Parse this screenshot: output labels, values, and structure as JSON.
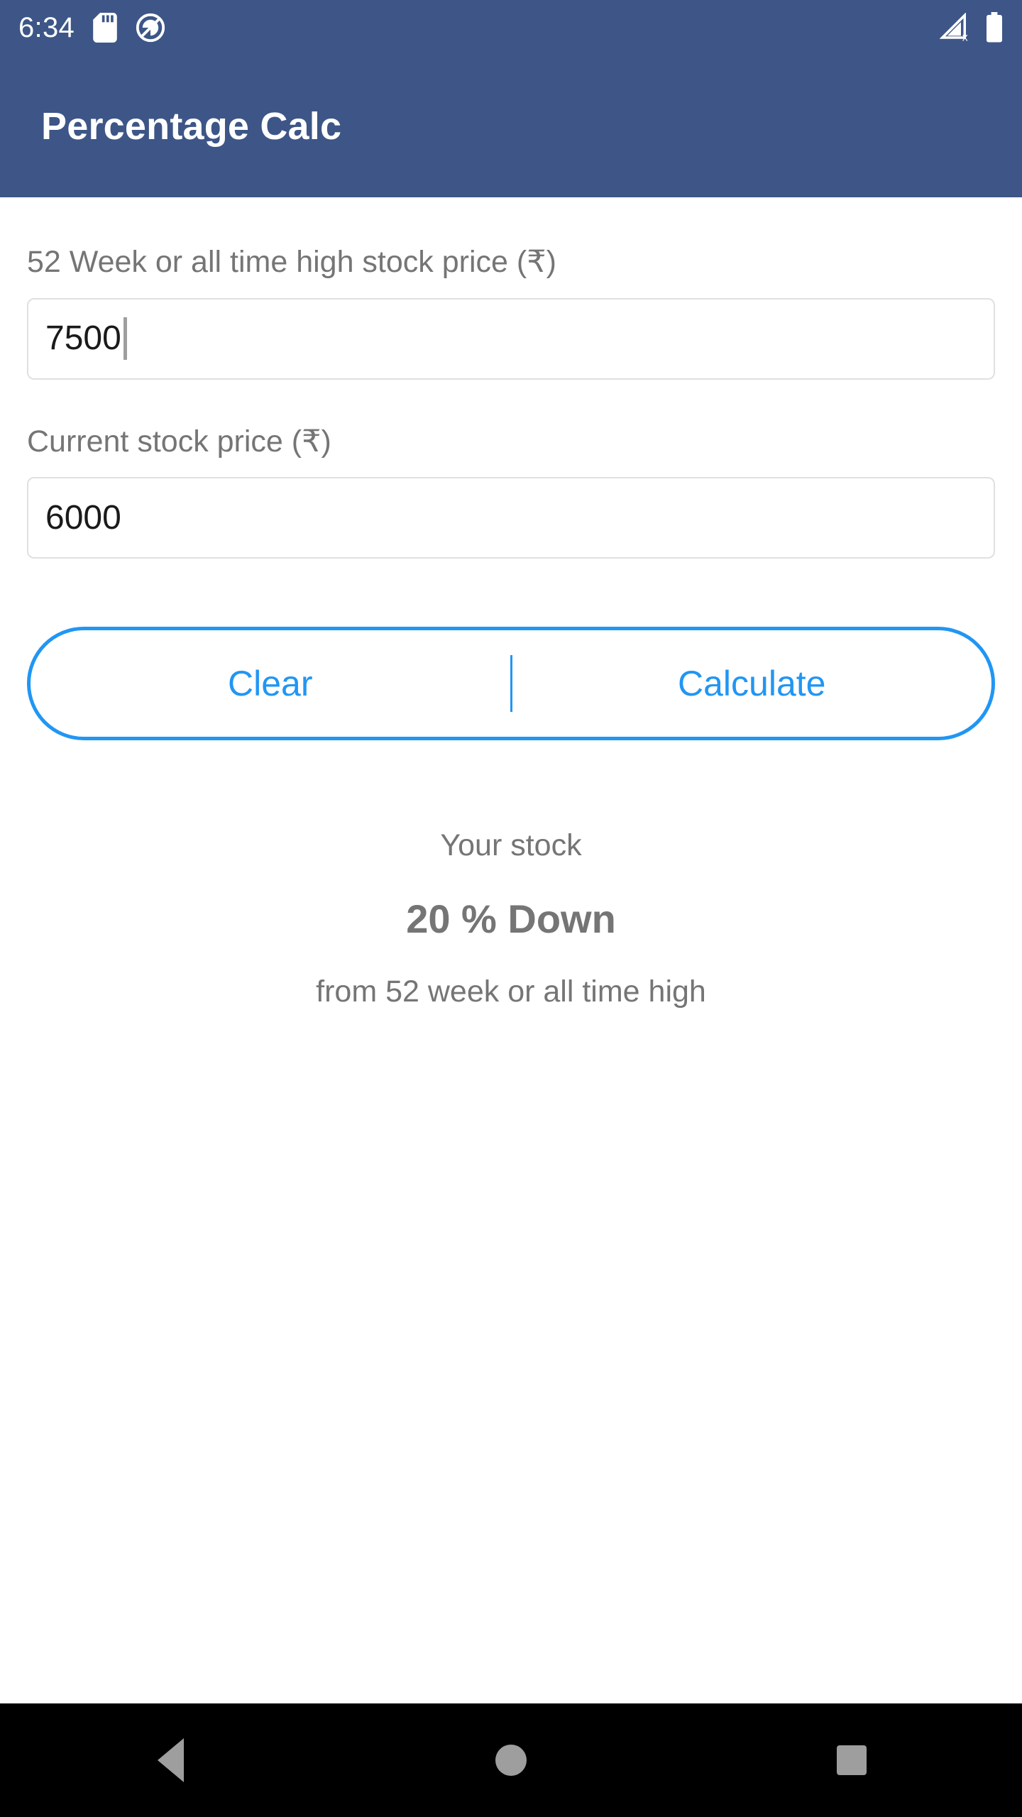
{
  "status_bar": {
    "time": "6:34",
    "left_icons": [
      "sd-card-icon",
      "data-saver-off-icon"
    ],
    "right_icons": [
      "no-signal-icon",
      "battery-full-icon"
    ],
    "background_color": "#3d5687",
    "foreground_color": "#ffffff"
  },
  "app_bar": {
    "title": "Percentage Calc",
    "background_color": "#3d5687",
    "title_color": "#ffffff"
  },
  "form": {
    "high_price": {
      "label": "52 Week or all time high stock price (₹)",
      "value": "7500",
      "placeholder": "",
      "focused": true
    },
    "current_price": {
      "label": "Current stock price (₹)",
      "value": "6000",
      "placeholder": "",
      "focused": false
    }
  },
  "buttons": {
    "clear_label": "Clear",
    "calculate_label": "Calculate",
    "accent_color": "#2196f3"
  },
  "result": {
    "top_text": "Your stock",
    "main_text": "20 % Down",
    "sub_text": "from 52 week or all time high",
    "text_color": "#757575"
  },
  "nav_bar": {
    "back": "back-icon",
    "home": "home-icon",
    "recents": "recents-icon",
    "background_color": "#000000"
  }
}
